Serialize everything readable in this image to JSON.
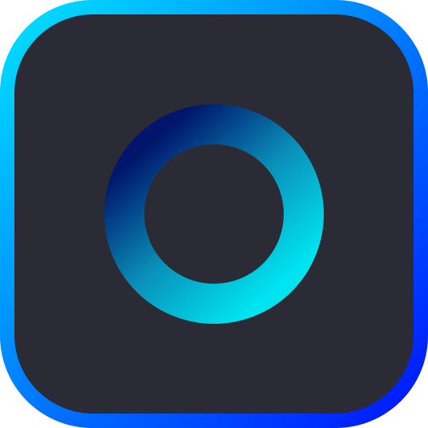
{
  "icon": {
    "name": "ring-app-icon",
    "border_gradient": {
      "start": "#00E5FF",
      "end": "#0011FF"
    },
    "background": "#2A2B34",
    "ring_gradient": {
      "start": "#00156B",
      "mid": "#0A8EB8",
      "end": "#00E3F0"
    }
  }
}
